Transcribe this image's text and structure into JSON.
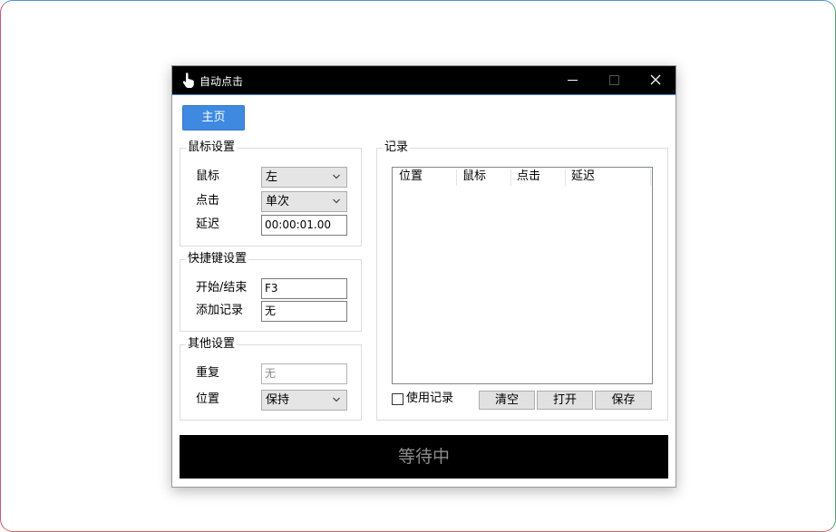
{
  "window": {
    "title": "自动点击",
    "controls": [
      "minimize-icon",
      "maximize-icon",
      "close-icon"
    ]
  },
  "home_button": "主页",
  "mouse_settings": {
    "title": "鼠标设置",
    "mouse_label": "鼠标",
    "mouse_value": "左",
    "click_label": "点击",
    "click_value": "单次",
    "delay_label": "延迟",
    "delay_value": "00:00:01.00"
  },
  "hotkey_settings": {
    "title": "快捷键设置",
    "start_stop_label": "开始/结束",
    "start_stop_value": "F3",
    "add_record_label": "添加记录",
    "add_record_value": "无"
  },
  "other_settings": {
    "title": "其他设置",
    "repeat_label": "重复",
    "repeat_placeholder": "无",
    "position_label": "位置",
    "position_value": "保持"
  },
  "records": {
    "title": "记录",
    "columns": [
      "位置",
      "鼠标",
      "点击",
      "延迟"
    ],
    "rows": [],
    "use_record_label": "使用记录",
    "use_record_checked": false,
    "clear_button": "清空",
    "open_button": "打开",
    "save_button": "保存"
  },
  "status": "等待中",
  "colors": {
    "titlebar": "#000000",
    "accent": "#3f8ae0",
    "status_bar": "#000000",
    "status_text": "#8c8c8c"
  }
}
